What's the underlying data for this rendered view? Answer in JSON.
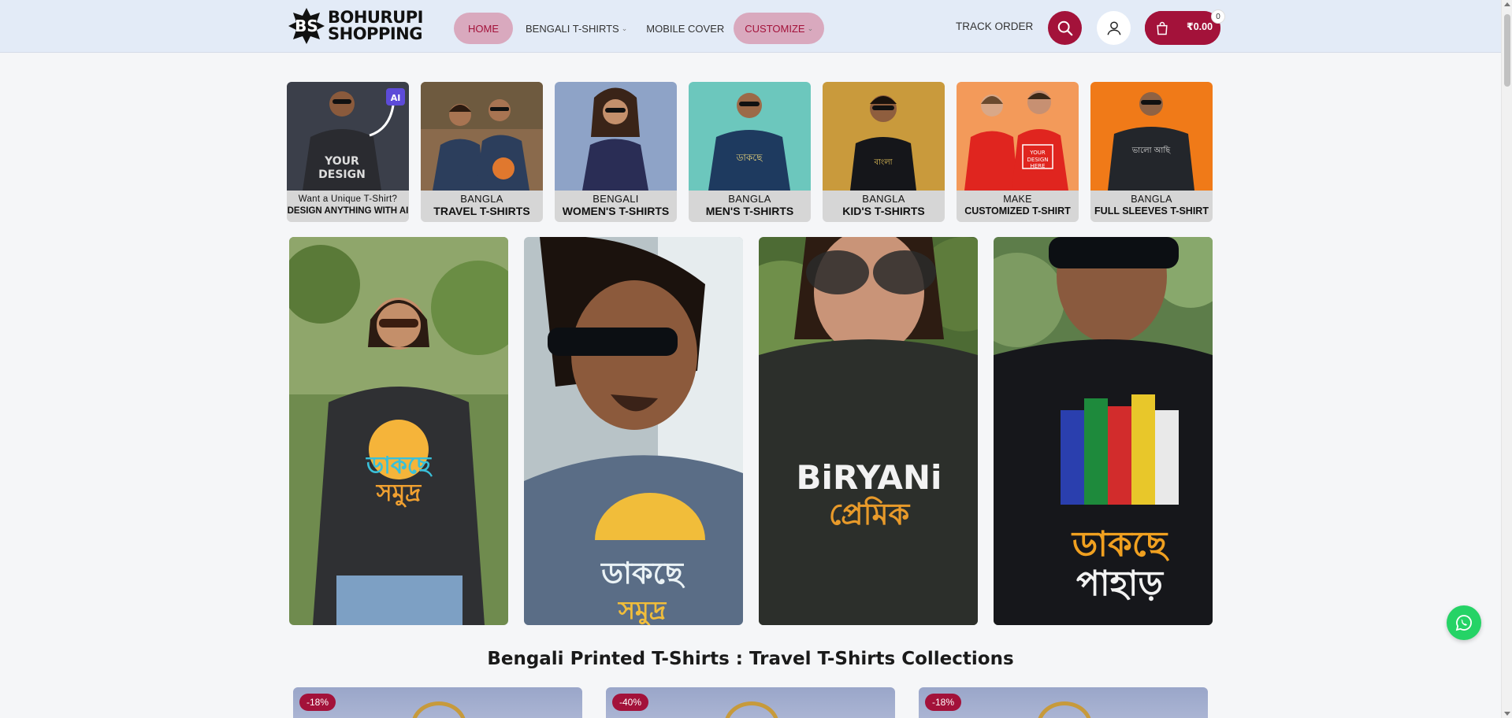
{
  "header": {
    "logo_line1": "BOHURUPI",
    "logo_line2": "SHOPPING",
    "nav": [
      {
        "label": "HOME"
      },
      {
        "label": "BENGALI T-SHIRTS"
      },
      {
        "label": "MOBILE COVER"
      },
      {
        "label": "CUSTOMIZE"
      }
    ],
    "track_order": "TRACK ORDER",
    "cart_total": "₹0.00",
    "cart_count": "0",
    "accent_color": "#a3123a"
  },
  "categories": [
    {
      "line1": "Want a Unique T-Shirt?",
      "line2": "DESIGN ANYTHING WITH AI",
      "badge": "AI"
    },
    {
      "line1": "BANGLA",
      "line2": "TRAVEL T-SHIRTS"
    },
    {
      "line1": "BENGALI",
      "line2": "WOMEN'S T-SHIRTS"
    },
    {
      "line1": "BANGLA",
      "line2": "MEN'S T-SHIRTS"
    },
    {
      "line1": "BANGLA",
      "line2": "KID'S T-SHIRTS"
    },
    {
      "line1": "MAKE",
      "line2": "CUSTOMIZED T-SHIRT"
    },
    {
      "line1": "BANGLA",
      "line2": "FULL SLEEVES T-SHIRT"
    }
  ],
  "section_title": "Bengali Printed T-Shirts : Travel T-Shirts Collections",
  "products": [
    {
      "discount": "-18%"
    },
    {
      "discount": "-40%"
    },
    {
      "discount": "-18%"
    }
  ],
  "icons": [
    "search-icon",
    "user-icon",
    "shopping-bag-icon",
    "whatsapp-icon",
    "chevron-down-icon"
  ]
}
